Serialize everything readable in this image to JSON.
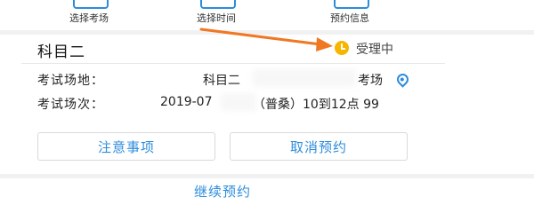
{
  "steps": [
    {
      "label": "选择考场"
    },
    {
      "label": "选择时间"
    },
    {
      "label": "预约信息"
    }
  ],
  "card": {
    "subject": "科目二",
    "status": "受理中",
    "venue_label": "考试场地：",
    "venue_value_left": "科目二",
    "venue_value_right": "考场",
    "session_label": "考试场次：",
    "session_value_left": "2019-07",
    "session_value_right": "（普桑）10到12点 99"
  },
  "buttons": {
    "notice": "注意事项",
    "cancel": "取消预约"
  },
  "continue_label": "继续预约",
  "colors": {
    "accent": "#2c8cdc",
    "status": "#f7b500",
    "annotation_arrow": "#f07823"
  },
  "icons": {
    "status": "clock-icon",
    "venue": "location-pin-icon"
  }
}
